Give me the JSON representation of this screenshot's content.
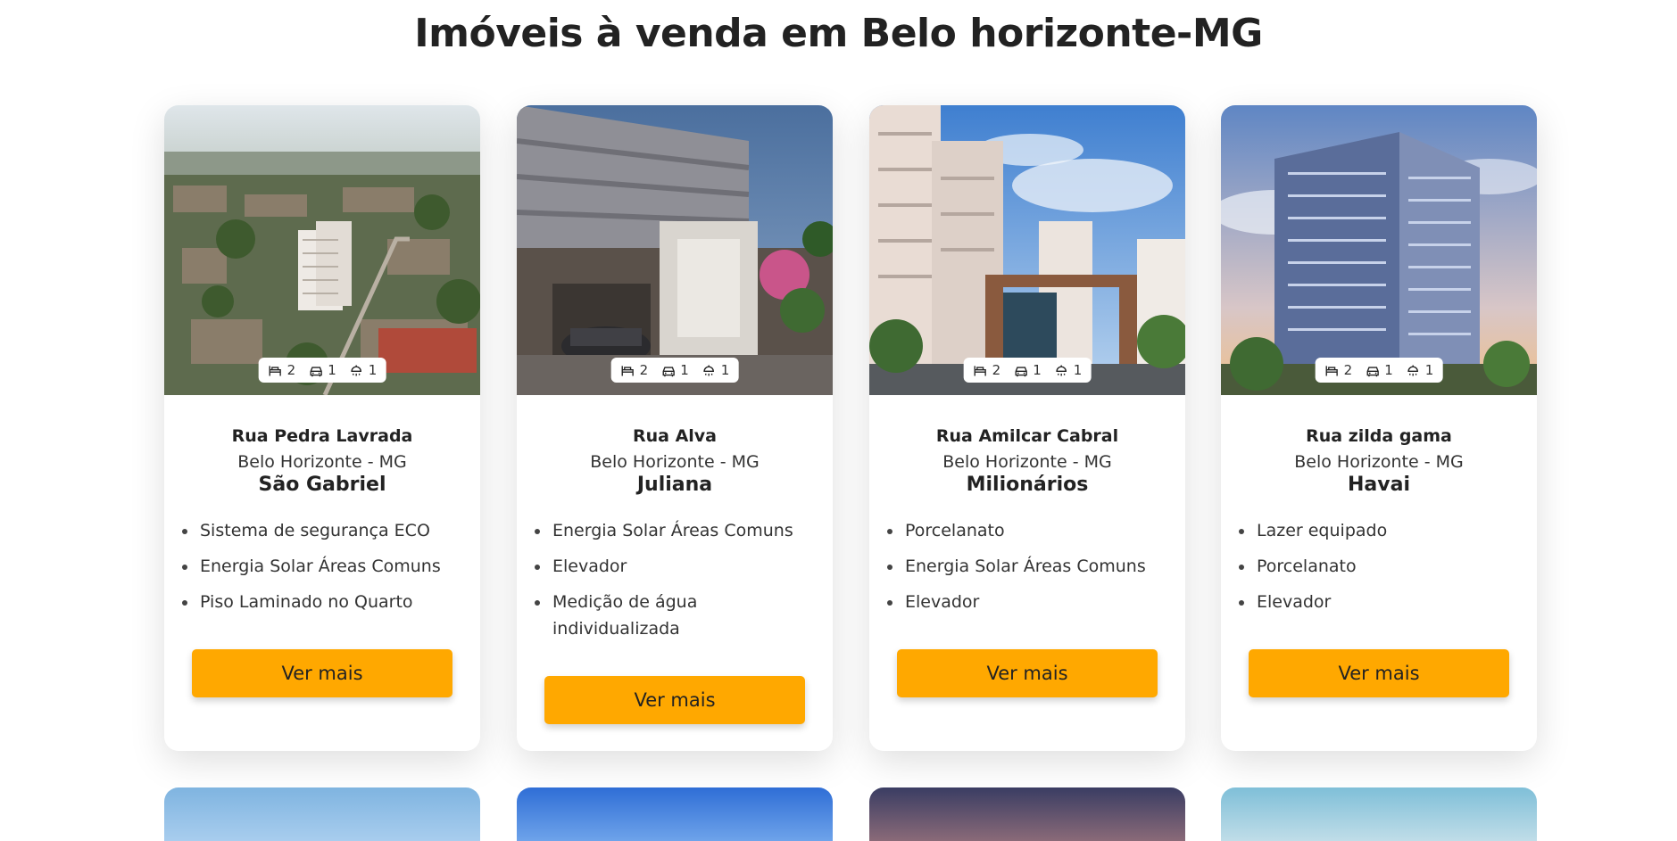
{
  "page": {
    "title": "Imóveis à venda em Belo horizonte-MG"
  },
  "cards": [
    {
      "features": {
        "bedrooms": "2",
        "parking": "1",
        "bathrooms": "1"
      },
      "street": "Rua Pedra Lavrada",
      "city": "Belo Horizonte - MG",
      "neighborhood": "São Gabriel",
      "amenities": [
        "Sistema de segurança ECO",
        "Energia Solar Áreas Comuns",
        "Piso Laminado no Quarto"
      ],
      "button": "Ver mais"
    },
    {
      "features": {
        "bedrooms": "2",
        "parking": "1",
        "bathrooms": "1"
      },
      "street": "Rua Alva",
      "city": "Belo Horizonte - MG",
      "neighborhood": "Juliana",
      "amenities": [
        "Energia Solar Áreas Comuns",
        "Elevador",
        "Medição de água individualizada"
      ],
      "button": "Ver mais"
    },
    {
      "features": {
        "bedrooms": "2",
        "parking": "1",
        "bathrooms": "1"
      },
      "street": "Rua Amilcar Cabral",
      "city": "Belo Horizonte - MG",
      "neighborhood": "Milionários",
      "amenities": [
        "Porcelanato",
        "Energia Solar Áreas Comuns",
        "Elevador"
      ],
      "button": "Ver mais"
    },
    {
      "features": {
        "bedrooms": "2",
        "parking": "1",
        "bathrooms": "1"
      },
      "street": "Rua zilda gama",
      "city": "Belo Horizonte - MG",
      "neighborhood": "Havai",
      "amenities": [
        "Lazer equipado",
        "Porcelanato",
        "Elevador"
      ],
      "button": "Ver mais"
    }
  ],
  "icons": {
    "bedrooms": "bed-icon",
    "parking": "car-icon",
    "bathrooms": "shower-icon"
  },
  "colors": {
    "accent": "#ffa800",
    "text": "#222222"
  }
}
